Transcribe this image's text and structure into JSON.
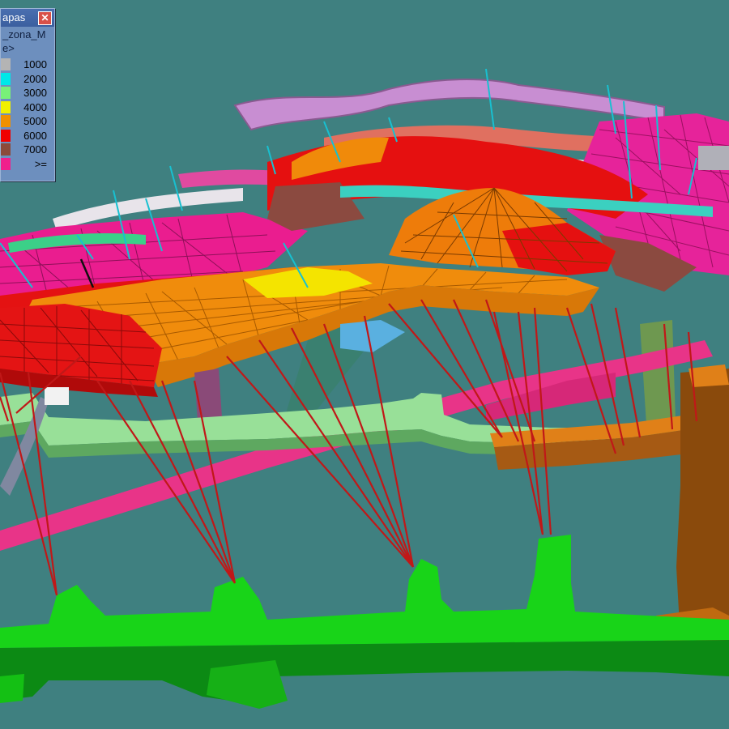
{
  "legend": {
    "title": "apas",
    "field_name": "_zona_M",
    "field_sub": "e>",
    "close_label": "✕",
    "close_icon": "close-icon",
    "items": [
      {
        "label": "1000",
        "color": "#b4b4b4"
      },
      {
        "label": "2000",
        "color": "#00e8e8"
      },
      {
        "label": "3000",
        "color": "#78f078"
      },
      {
        "label": "4000",
        "color": "#f0f000"
      },
      {
        "label": "5000",
        "color": "#f09000"
      },
      {
        "label": "6000",
        "color": "#f00000"
      },
      {
        "label": "7000",
        "color": "#8c4a3a"
      },
      {
        "label": ">=",
        "color": "#f0208c"
      }
    ]
  },
  "colors": {
    "background": "#3f8080",
    "drillhole": "#c01818",
    "pink_zone": "#ee1f8c",
    "red_zone": "#e80f0f",
    "orange_zone": "#f08a0a",
    "green_level": "#14d014",
    "lightgreen_level": "#90e090",
    "brown_ramp": "#8a4a10"
  }
}
